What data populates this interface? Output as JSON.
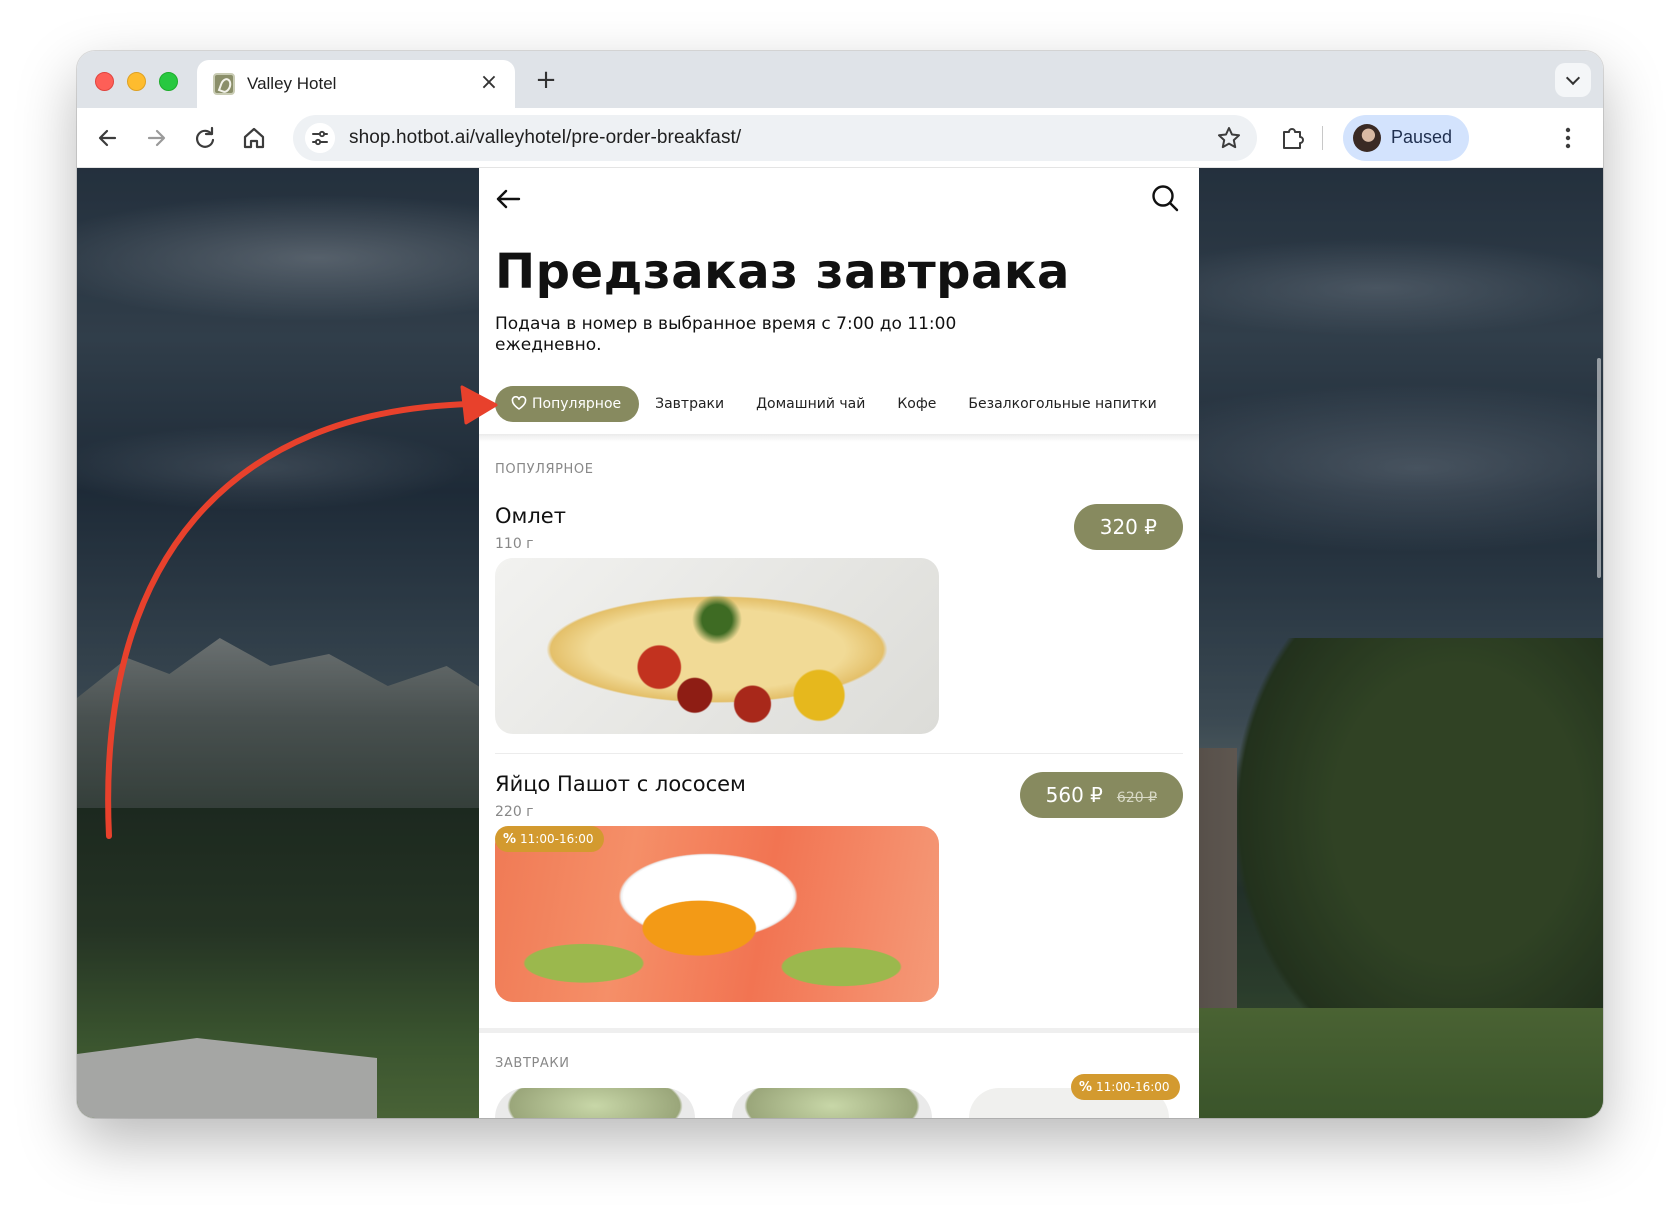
{
  "browser": {
    "tab_title": "Valley Hotel",
    "close_glyph": "×",
    "new_tab_glyph": "+",
    "url": "shop.hotbot.ai/valleyhotel/pre-order-breakfast/",
    "profile_label": "Paused"
  },
  "page": {
    "title": "Предзаказ завтрака",
    "subtitle": "Подача в номер в выбранное время с 7:00 до 11:00 ежедневно."
  },
  "categories": [
    {
      "label": "Популярное",
      "active": true,
      "icon": "heart-icon"
    },
    {
      "label": "Завтраки",
      "active": false
    },
    {
      "label": "Домашний чай",
      "active": false
    },
    {
      "label": "Кофе",
      "active": false
    },
    {
      "label": "Безалкогольные напитки",
      "active": false
    }
  ],
  "sections": {
    "popular_label": "ПОПУЛЯРНОЕ",
    "breakfasts_label": "ЗАВТРАКИ"
  },
  "items": [
    {
      "name": "Омлет",
      "weight": "110 г",
      "price": "320 ₽",
      "old_price": null,
      "promo": null
    },
    {
      "name": "Яйцо Пашот с лососем",
      "weight": "220 г",
      "price": "560 ₽",
      "old_price": "620 ₽",
      "promo": "11:00-16:00"
    }
  ],
  "bottom_promo": "11:00-16:00",
  "colors": {
    "accent_olive": "#878a5f",
    "promo_amber": "#d39a2f",
    "annotation_arrow": "#e8412c"
  }
}
